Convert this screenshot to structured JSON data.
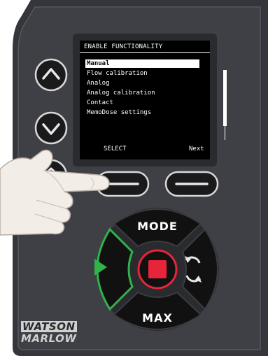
{
  "screen": {
    "title": "ENABLE FUNCTIONALITY",
    "items": [
      {
        "label": "Manual",
        "selected": true
      },
      {
        "label": "Flow calibration",
        "selected": false
      },
      {
        "label": "Analog",
        "selected": false
      },
      {
        "label": "Analog calibration",
        "selected": false
      },
      {
        "label": "Contact",
        "selected": false
      },
      {
        "label": "MemoDose settings",
        "selected": false
      }
    ],
    "softkey_left": "SELECT",
    "softkey_right": "Next"
  },
  "keys": {
    "mode": "MODE",
    "max": "MAX"
  },
  "brand": {
    "line1": "WATSON",
    "line2": "MARLOW"
  },
  "colors": {
    "body": "#3b3d42",
    "bezel": "#4a4c52",
    "start": "#2fb34a",
    "stop": "#e8243a",
    "key": "#111111"
  },
  "icons": [
    "up-arrow-icon",
    "down-arrow-icon",
    "home-icon",
    "play-icon",
    "stop-icon",
    "refresh-icon"
  ]
}
